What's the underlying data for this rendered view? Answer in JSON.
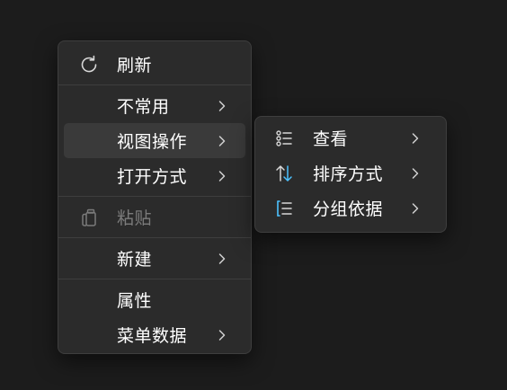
{
  "main_menu": {
    "refresh": {
      "label": "刷新",
      "icon": "refresh-icon"
    },
    "uncommon": {
      "label": "不常用"
    },
    "view_ops": {
      "label": "视图操作"
    },
    "open_with": {
      "label": "打开方式"
    },
    "paste": {
      "label": "粘贴",
      "icon": "clipboard-icon",
      "disabled": true
    },
    "new": {
      "label": "新建"
    },
    "properties": {
      "label": "属性"
    },
    "menu_data": {
      "label": "菜单数据"
    }
  },
  "sub_menu": {
    "view": {
      "label": "查看",
      "icon": "view-list-icon"
    },
    "sort": {
      "label": "排序方式",
      "icon": "sort-icon"
    },
    "group": {
      "label": "分组依据",
      "icon": "group-list-icon"
    }
  },
  "colors": {
    "background": "#1c1c1c",
    "menu_bg": "#2b2b2b",
    "hover_bg": "#3a3a3a",
    "text": "#ffffff",
    "disabled_text": "#7b7b7b",
    "accent": "#4cc2ff"
  }
}
